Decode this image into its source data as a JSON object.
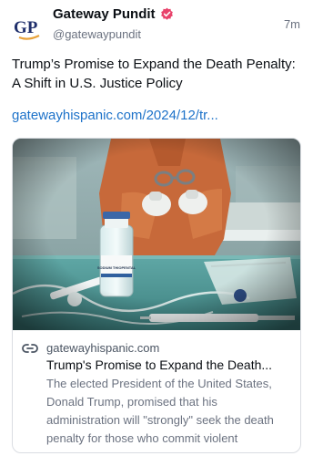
{
  "author": {
    "display_name": "Gateway Pundit",
    "handle": "@gatewaypundit",
    "avatar_text": "GP",
    "verified": true
  },
  "post": {
    "timestamp": "7m",
    "text": "Trump’s Promise to Expand the Death Penalty: A Shift in U.S. Justice Policy",
    "link_text": "gatewayhispanic.com/2024/12/tr..."
  },
  "card": {
    "domain": "gatewayhispanic.com",
    "title": "Trump's Promise to Expand the Death...",
    "description": "The elected President of the United States, Donald Trump, promised that his administration will \"strongly\" seek the death penalty for those who commit violent",
    "vial_label": "SODIUM THIOPENTAL"
  },
  "colors": {
    "link": "#1d72c9",
    "verified_badge": "#e8436b",
    "avatar_navy": "#1f2f6b"
  }
}
